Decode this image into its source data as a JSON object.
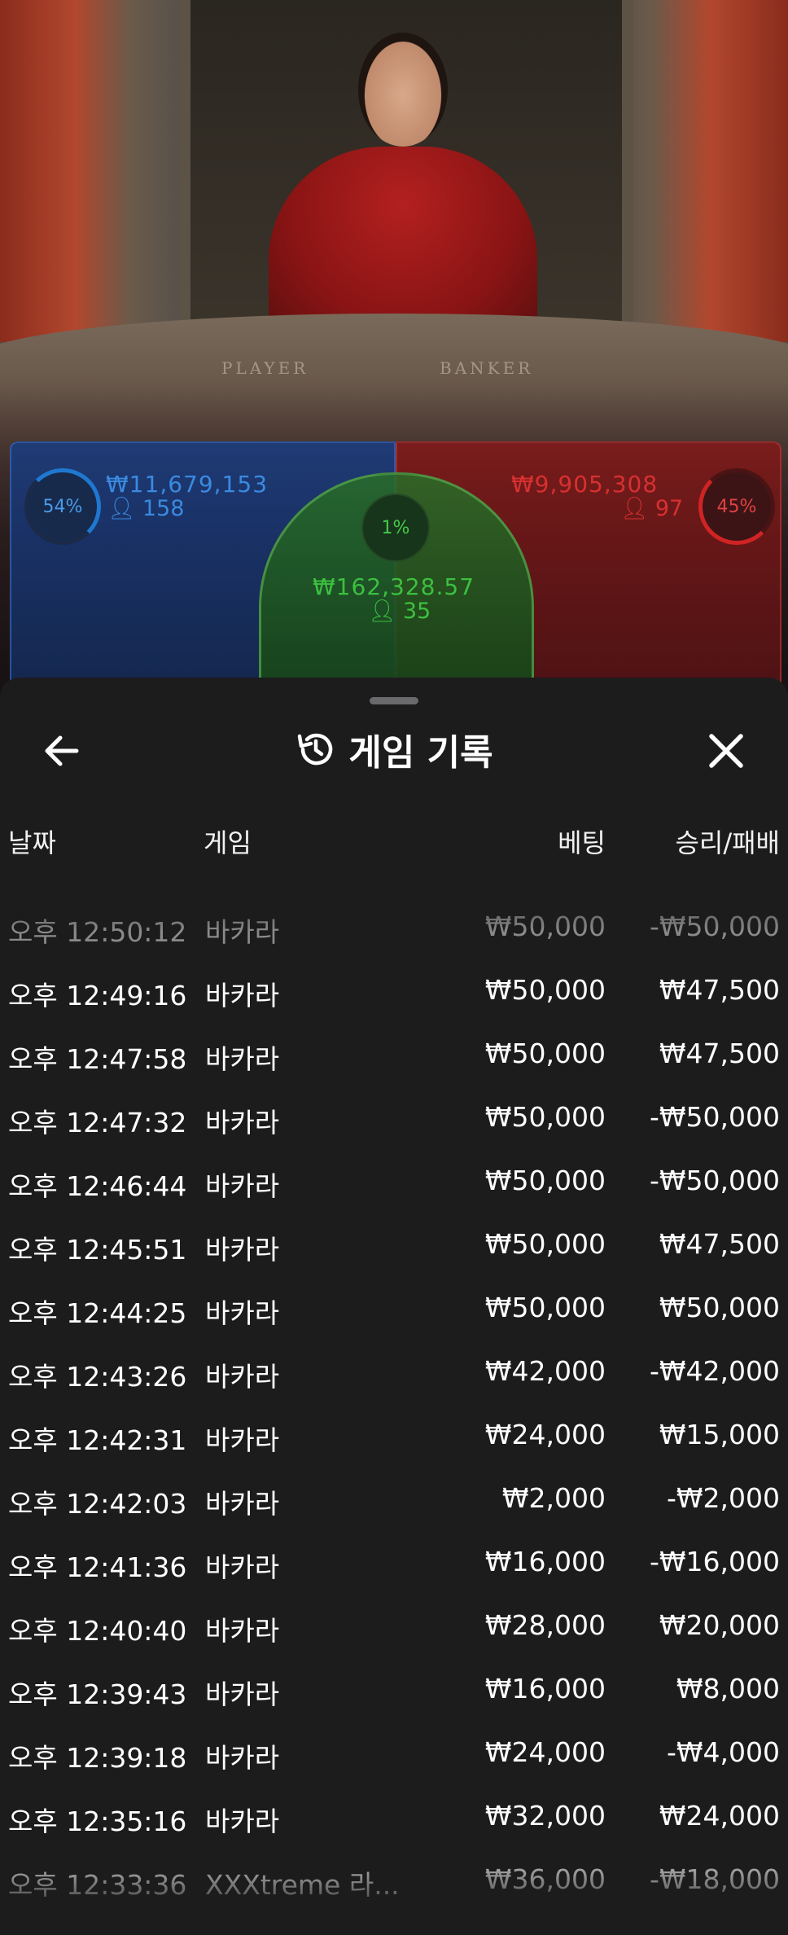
{
  "video": {
    "table_player_text": "PLAYER",
    "table_banker_text": "BANKER",
    "player": {
      "percent": "54%",
      "amount": "₩11,679,153",
      "count": "158",
      "color": "#1f78d0"
    },
    "tie": {
      "percent": "1%",
      "amount": "₩162,328.57",
      "count": "35",
      "color": "#45c84a"
    },
    "banker": {
      "percent": "45%",
      "amount": "₩9,905,308",
      "count": "97",
      "color": "#d02424"
    }
  },
  "sheet": {
    "title": "게임 기록",
    "title_icon": "history-icon",
    "back_icon": "arrow-left-icon",
    "close_icon": "close-icon",
    "columns": {
      "date": "날짜",
      "game": "게임",
      "bet": "베팅",
      "win_loss": "승리/패배"
    },
    "rows": [
      {
        "date": "오후 12:50:12",
        "game": "바카라",
        "bet": "₩50,000",
        "win_loss": "-₩50,000"
      },
      {
        "date": "오후 12:49:16",
        "game": "바카라",
        "bet": "₩50,000",
        "win_loss": "₩47,500"
      },
      {
        "date": "오후 12:47:58",
        "game": "바카라",
        "bet": "₩50,000",
        "win_loss": "₩47,500"
      },
      {
        "date": "오후 12:47:32",
        "game": "바카라",
        "bet": "₩50,000",
        "win_loss": "-₩50,000"
      },
      {
        "date": "오후 12:46:44",
        "game": "바카라",
        "bet": "₩50,000",
        "win_loss": "-₩50,000"
      },
      {
        "date": "오후 12:45:51",
        "game": "바카라",
        "bet": "₩50,000",
        "win_loss": "₩47,500"
      },
      {
        "date": "오후 12:44:25",
        "game": "바카라",
        "bet": "₩50,000",
        "win_loss": "₩50,000"
      },
      {
        "date": "오후 12:43:26",
        "game": "바카라",
        "bet": "₩42,000",
        "win_loss": "-₩42,000"
      },
      {
        "date": "오후 12:42:31",
        "game": "바카라",
        "bet": "₩24,000",
        "win_loss": "₩15,000"
      },
      {
        "date": "오후 12:42:03",
        "game": "바카라",
        "bet": "₩2,000",
        "win_loss": "-₩2,000"
      },
      {
        "date": "오후 12:41:36",
        "game": "바카라",
        "bet": "₩16,000",
        "win_loss": "-₩16,000"
      },
      {
        "date": "오후 12:40:40",
        "game": "바카라",
        "bet": "₩28,000",
        "win_loss": "₩20,000"
      },
      {
        "date": "오후 12:39:43",
        "game": "바카라",
        "bet": "₩16,000",
        "win_loss": "₩8,000"
      },
      {
        "date": "오후 12:39:18",
        "game": "바카라",
        "bet": "₩24,000",
        "win_loss": "-₩4,000"
      },
      {
        "date": "오후 12:35:16",
        "game": "바카라",
        "bet": "₩32,000",
        "win_loss": "₩24,000"
      },
      {
        "date": "오후 12:33:36",
        "game": "XXXtreme 라...",
        "bet": "₩36,000",
        "win_loss": "-₩18,000"
      }
    ]
  }
}
